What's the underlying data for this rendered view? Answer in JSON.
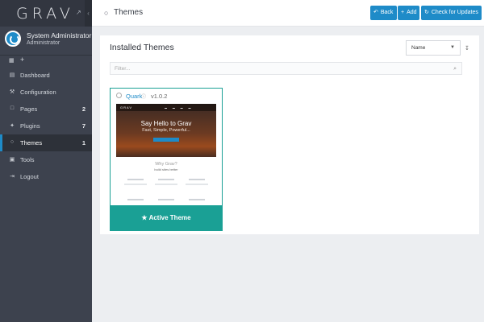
{
  "sidebar": {
    "logo": "GRAV",
    "user_name": "System Administrator",
    "user_role": "Administrator",
    "items": [
      {
        "label": "Dashboard",
        "icon": "▤",
        "badge": ""
      },
      {
        "label": "Configuration",
        "icon": "⚒",
        "badge": ""
      },
      {
        "label": "Pages",
        "icon": "□",
        "badge": "2"
      },
      {
        "label": "Plugins",
        "icon": "✦",
        "badge": "7"
      },
      {
        "label": "Themes",
        "icon": "○",
        "badge": "1"
      },
      {
        "label": "Tools",
        "icon": "▣",
        "badge": ""
      },
      {
        "label": "Logout",
        "icon": "⇥",
        "badge": ""
      }
    ],
    "active": "Themes",
    "accent": "#1e8bc8"
  },
  "header": {
    "title": "Themes",
    "back_label": "Back",
    "add_label": "Add",
    "check_label": "Check for Updates",
    "button_color": "#1e8bc8"
  },
  "panel": {
    "title": "Installed Themes",
    "sort_value": "Name",
    "filter_placeholder": "Filter..."
  },
  "theme_card": {
    "name": "Quark",
    "version": "v1.0.2",
    "active_label": "Active Theme",
    "active_color": "#1aa095",
    "preview": {
      "logo": "GRAV",
      "headline": "Say Hello to Grav",
      "subheadline": "Fast, Simple, Powerful...",
      "why": "Why Grav?",
      "why_sub": "build sites better"
    }
  }
}
